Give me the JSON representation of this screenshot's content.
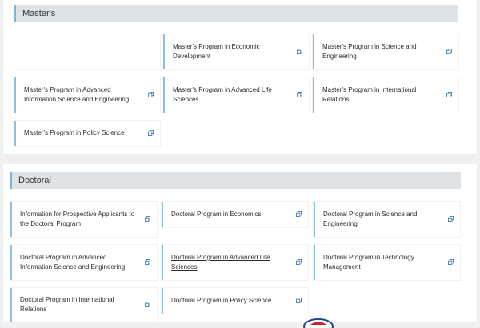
{
  "masters": {
    "heading": "Master's",
    "cards": [
      {
        "label": ""
      },
      {
        "label": "Master's Program in Economic Development"
      },
      {
        "label": "Master's Program in Science and Engineering"
      },
      {
        "label": "Master's Program in Advanced Information Science and Engineering"
      },
      {
        "label": "Master's Program in Advanced Life Sciences"
      },
      {
        "label": "Master's Program in International Relations"
      },
      {
        "label": "Master's Program in Policy Science"
      }
    ]
  },
  "doctoral": {
    "heading": "Doctoral",
    "cards": [
      {
        "label": "Information for Prospective Applicants to the Doctoral Program"
      },
      {
        "label": "Doctoral Program in Economics"
      },
      {
        "label": "Doctoral Program in Science and Engineering"
      },
      {
        "label": "Doctoral Program in Advanced Information Science and Engineering"
      },
      {
        "label": "Doctoral Program in Advanced Life Sciences"
      },
      {
        "label": "Doctoral Program in Technology Management"
      },
      {
        "label": "Doctoral Program in International Relations"
      },
      {
        "label": "Doctoral Program in Policy Science"
      }
    ]
  },
  "icons": {
    "external_link": "external-link-icon"
  },
  "colors": {
    "page_background": "#eef0f2",
    "header_background": "#dfe3e6",
    "accent_border": "#8fc1dc",
    "icon_color": "#3a7fc0"
  }
}
